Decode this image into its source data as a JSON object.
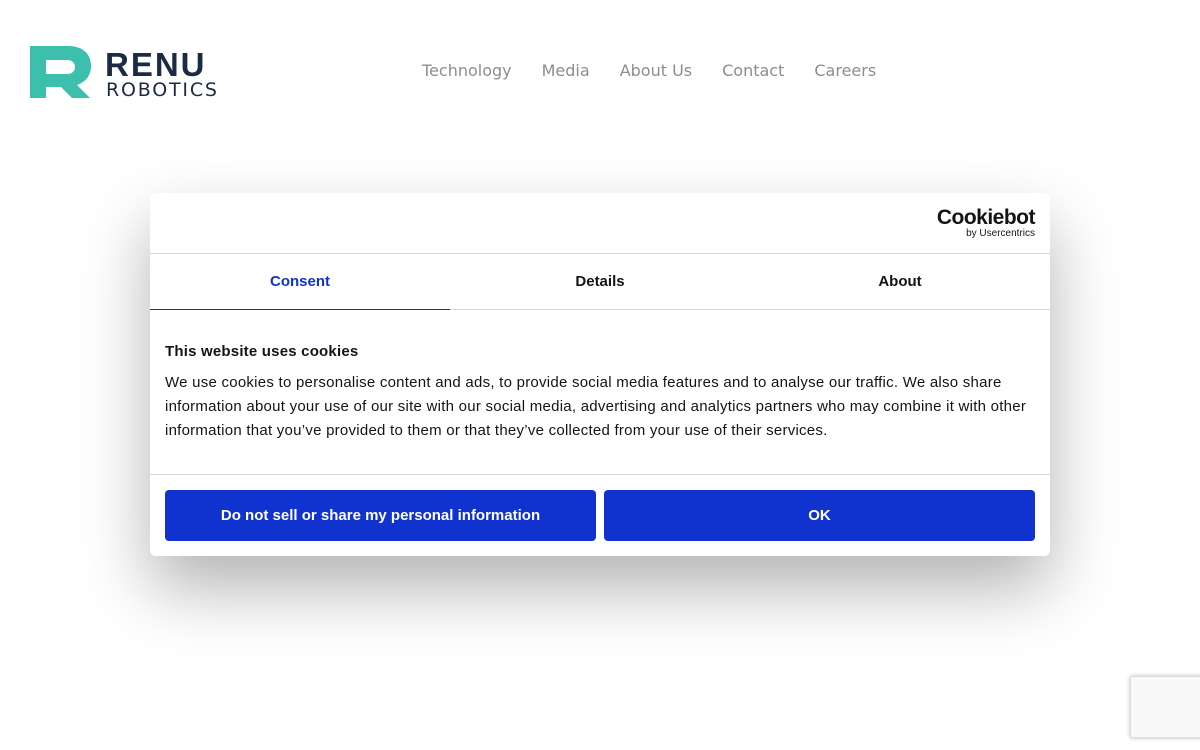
{
  "header": {
    "logo": {
      "line1": "RENU",
      "line2": "ROBOTICS",
      "colors": {
        "accent": "#3cc0ad",
        "text": "#1b2b44"
      }
    },
    "nav": [
      {
        "label": "Technology"
      },
      {
        "label": "Media"
      },
      {
        "label": "About Us"
      },
      {
        "label": "Contact"
      },
      {
        "label": "Careers"
      }
    ]
  },
  "cookie_dialog": {
    "provider": {
      "brand": "Cookiebot",
      "byline": "by Usercentrics"
    },
    "tabs": [
      {
        "label": "Consent",
        "active": true
      },
      {
        "label": "Details",
        "active": false
      },
      {
        "label": "About",
        "active": false
      }
    ],
    "title": "This website uses cookies",
    "text": "We use cookies to personalise content and ads, to provide social media features and to analyse our traffic. We also share information about your use of our site with our social media, advertising and analytics partners who may combine it with other information that you’ve provided to them or that they’ve collected from your use of their services.",
    "buttons": {
      "decline_label": "Do not sell or share my personal information",
      "ok_label": "OK"
    },
    "colors": {
      "primary": "#1032cf"
    }
  },
  "recaptcha": {
    "icon": "recaptcha-icon"
  }
}
